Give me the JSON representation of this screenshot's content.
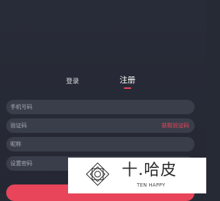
{
  "tabs": {
    "login_label": "登录",
    "register_label": "注册",
    "active": "register"
  },
  "form": {
    "phone_placeholder": "手机号码",
    "code_placeholder": "验证码",
    "get_code_label": "获取验证码",
    "nickname_placeholder": "昵称",
    "password_placeholder": "设置密码"
  },
  "watermark": {
    "brand_text": "十.哈皮",
    "sub_text": "TEN HAPPY"
  },
  "colors": {
    "background": "#262a35",
    "field": "#3a3e4a",
    "accent": "#f0465a"
  }
}
